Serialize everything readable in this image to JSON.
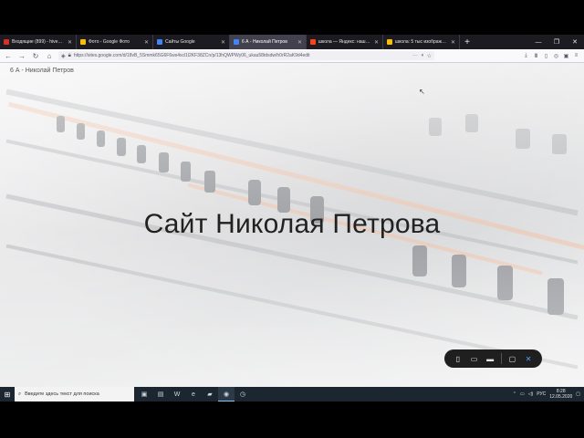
{
  "browser": {
    "tabs": [
      {
        "title": "Входящие (899) - hivenbor@ya...",
        "favicon_color": "#d93025",
        "active": false
      },
      {
        "title": "Фото - Google Фото",
        "favicon_color": "#fbbc04",
        "active": false
      },
      {
        "title": "Сайты Google",
        "favicon_color": "#4285f4",
        "active": false
      },
      {
        "title": "6 А - Николай Петров",
        "favicon_color": "#4285f4",
        "active": true
      },
      {
        "title": "школа — Яндекс: нашлось 2 ...",
        "favicon_color": "#fc3f1d",
        "active": false
      },
      {
        "title": "школа: 5 тыс изображений н...",
        "favicon_color": "#fbbc04",
        "active": false
      }
    ],
    "new_tab_icon": "plus-icon",
    "url": "https://sites.google.com/d/18vB_5Smmk65G6F6ws4xcl1l2KF38ZCn/p/13hQWPWy06_ukau58tdsdw/h0rR2aK9d4edit",
    "url_domain": "sites.google.com"
  },
  "page": {
    "site_name": "6 А - Николай Петров",
    "hero_title": "Сайт Николая Петрова"
  },
  "taskbar": {
    "search_placeholder": "Введите здесь текст для поиска",
    "lang": "РУС",
    "time": "8:28",
    "date": "12.05.2020"
  },
  "colors": {
    "taskbar_bg": "#1b2630",
    "tabbar_bg": "#1c1b22",
    "fab_bg": "#1f1f1f",
    "accent": "#4ea1ff"
  }
}
